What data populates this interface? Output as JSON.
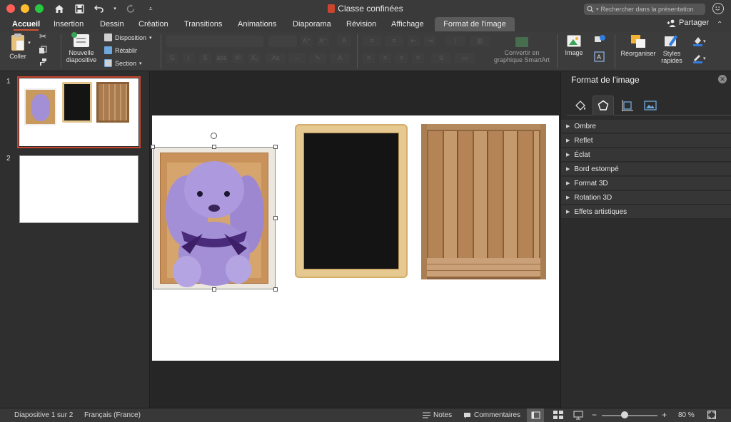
{
  "window": {
    "title": "Classe confinées",
    "search_placeholder": "Rechercher dans la présentation",
    "share_label": "Partager"
  },
  "tabs": [
    {
      "label": "Accueil"
    },
    {
      "label": "Insertion"
    },
    {
      "label": "Dessin"
    },
    {
      "label": "Création"
    },
    {
      "label": "Transitions"
    },
    {
      "label": "Animations"
    },
    {
      "label": "Diaporama"
    },
    {
      "label": "Révision"
    },
    {
      "label": "Affichage"
    },
    {
      "label": "Format de l'image"
    }
  ],
  "ribbon": {
    "paste": "Coller",
    "new_slide_line1": "Nouvelle",
    "new_slide_line2": "diapositive",
    "layout": "Disposition",
    "reset": "Rétablir",
    "section": "Section",
    "convert_line1": "Convertir en",
    "convert_line2": "graphique SmartArt",
    "picture": "Image",
    "arrange": "Réorganiser",
    "quick_styles_line1": "Styles",
    "quick_styles_line2": "rapides"
  },
  "thumbnails": [
    {
      "number": "1"
    },
    {
      "number": "2"
    }
  ],
  "pane": {
    "title": "Format de l'image",
    "sections": [
      "Ombre",
      "Reflet",
      "Éclat",
      "Bord estompé",
      "Format 3D",
      "Rotation 3D",
      "Effets artistiques"
    ]
  },
  "status": {
    "slide_info": "Diapositive 1 sur 2",
    "language": "Français (France)",
    "notes": "Notes",
    "comments": "Commentaires",
    "zoom": "80 %"
  },
  "colors": {
    "accent": "#d35230",
    "chalkboard": "#141414",
    "frame_wood": "#e2c48c",
    "crate_wood": "#a97b4f",
    "bunny": "#a38fd6"
  }
}
